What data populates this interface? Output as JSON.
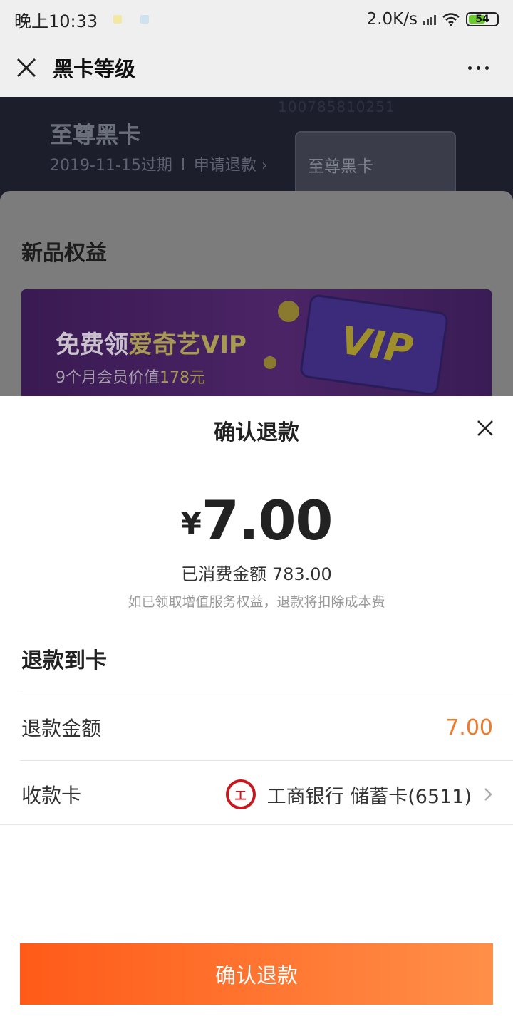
{
  "status_bar": {
    "time": "晚上10:33",
    "network_speed": "2.0K/s",
    "battery": "54"
  },
  "navbar": {
    "title": "黑卡等级",
    "close_icon": "close-icon",
    "more_icon": "more-dots-icon"
  },
  "background_page": {
    "watermark": "100785810251",
    "card_name": "至尊黑卡",
    "expiry": "2019-11-15过期",
    "apply_refund": "申请退款 ›",
    "card_label": "至尊黑卡",
    "section_title": "新品权益",
    "banner": {
      "prefix": "免费领",
      "brand": "爱奇艺VIP",
      "sub_prefix": "9个月会员价值",
      "sub_value": "178元",
      "vip_text": "VIP"
    }
  },
  "sheet": {
    "title": "确认退款",
    "currency": "¥",
    "amount": "7.00",
    "consumed": "已消费金额 783.00",
    "note": "如已领取增值服务权益，退款将扣除成本费",
    "refund_to_card_title": "退款到卡",
    "rows": [
      {
        "label": "退款金额",
        "value": "7.00"
      },
      {
        "label": "收款卡",
        "value": "工商银行 储蓄卡(6511)"
      }
    ],
    "bank_logo_text": "工",
    "confirm_button": "确认退款"
  },
  "colors": {
    "accent_orange": "#f07a2a",
    "button_gradient_start": "#ff5a18",
    "button_gradient_end": "#ff8f48",
    "icbc_red": "#c7161e"
  }
}
